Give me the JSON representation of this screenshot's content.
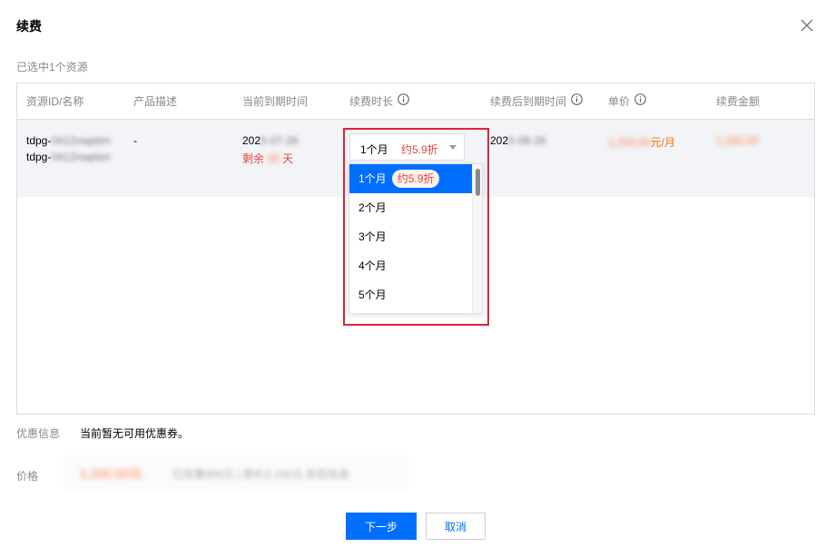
{
  "dialog": {
    "title": "续费",
    "selected_info": "已选中1个资源"
  },
  "table": {
    "headers": {
      "resource": "资源ID/名称",
      "description": "产品描述",
      "current_expiry": "当前到期时间",
      "duration": "续费时长",
      "new_expiry": "续费后到期时间",
      "unit_price": "单价",
      "amount": "续费金额"
    },
    "row": {
      "resource_id_prefix": "tdpg-",
      "resource_id_blurred": "0412nwpbm",
      "resource_name_prefix": "tdpg-",
      "resource_name_blurred": "0412nwpbm",
      "description": "-",
      "current_expiry_prefix": "202",
      "current_expiry_blurred": "5-07-26",
      "remaining_prefix": "剩余",
      "remaining_blurred": "30",
      "remaining_suffix": "天",
      "new_expiry_prefix": "202",
      "new_expiry_blurred": "5-08-26",
      "unit_price_blurred": "1,200.00",
      "unit_price_suffix": "元/月",
      "amount_blurred": "1,200.00"
    }
  },
  "duration_select": {
    "value": "1个月",
    "tag": "约5.9折",
    "options": [
      {
        "label": "1个月",
        "tag": "约5.9折"
      },
      {
        "label": "2个月"
      },
      {
        "label": "3个月"
      },
      {
        "label": "4个月"
      },
      {
        "label": "5个月"
      }
    ]
  },
  "coupon": {
    "label": "优惠信息",
    "text": "当前暂无可用优惠券。"
  },
  "price": {
    "label": "价格",
    "amount_blurred": "1,200.00元",
    "detail_blurred": "已优惠900元 | 原价2,100元 折扣信息"
  },
  "buttons": {
    "next": "下一步",
    "cancel": "取消"
  },
  "colors": {
    "primary": "#006eff",
    "danger": "#e54545",
    "price_orange": "#ff7200",
    "highlight": "#e0223a"
  }
}
